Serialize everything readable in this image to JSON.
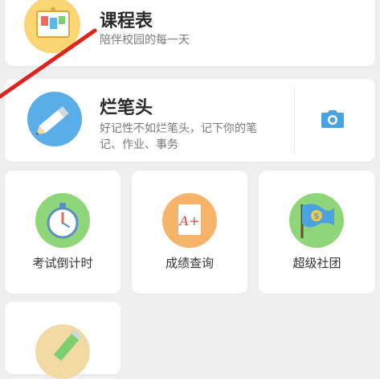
{
  "cards": {
    "timetable": {
      "title": "课程表",
      "subtitle": "陪伴校园的每一天",
      "icon": "timetable-board-icon"
    },
    "notes": {
      "title": "烂笔头",
      "subtitle_line1": "好记性不如烂笔头，记下你的笔",
      "subtitle_line2": "记、作业、事务",
      "icon": "pencil-icon",
      "action_icon": "camera-icon"
    }
  },
  "tiles": [
    {
      "label": "考试倒计时",
      "icon": "stopwatch-icon"
    },
    {
      "label": "成绩查询",
      "icon": "grade-paper-icon"
    },
    {
      "label": "超级社团",
      "icon": "club-flag-icon"
    },
    {
      "label": "",
      "icon": "pen-icon"
    }
  ],
  "colors": {
    "background": "#efefef",
    "card": "#ffffff",
    "accent_blue": "#4aa3e0",
    "annotation_red": "#e0221c"
  }
}
